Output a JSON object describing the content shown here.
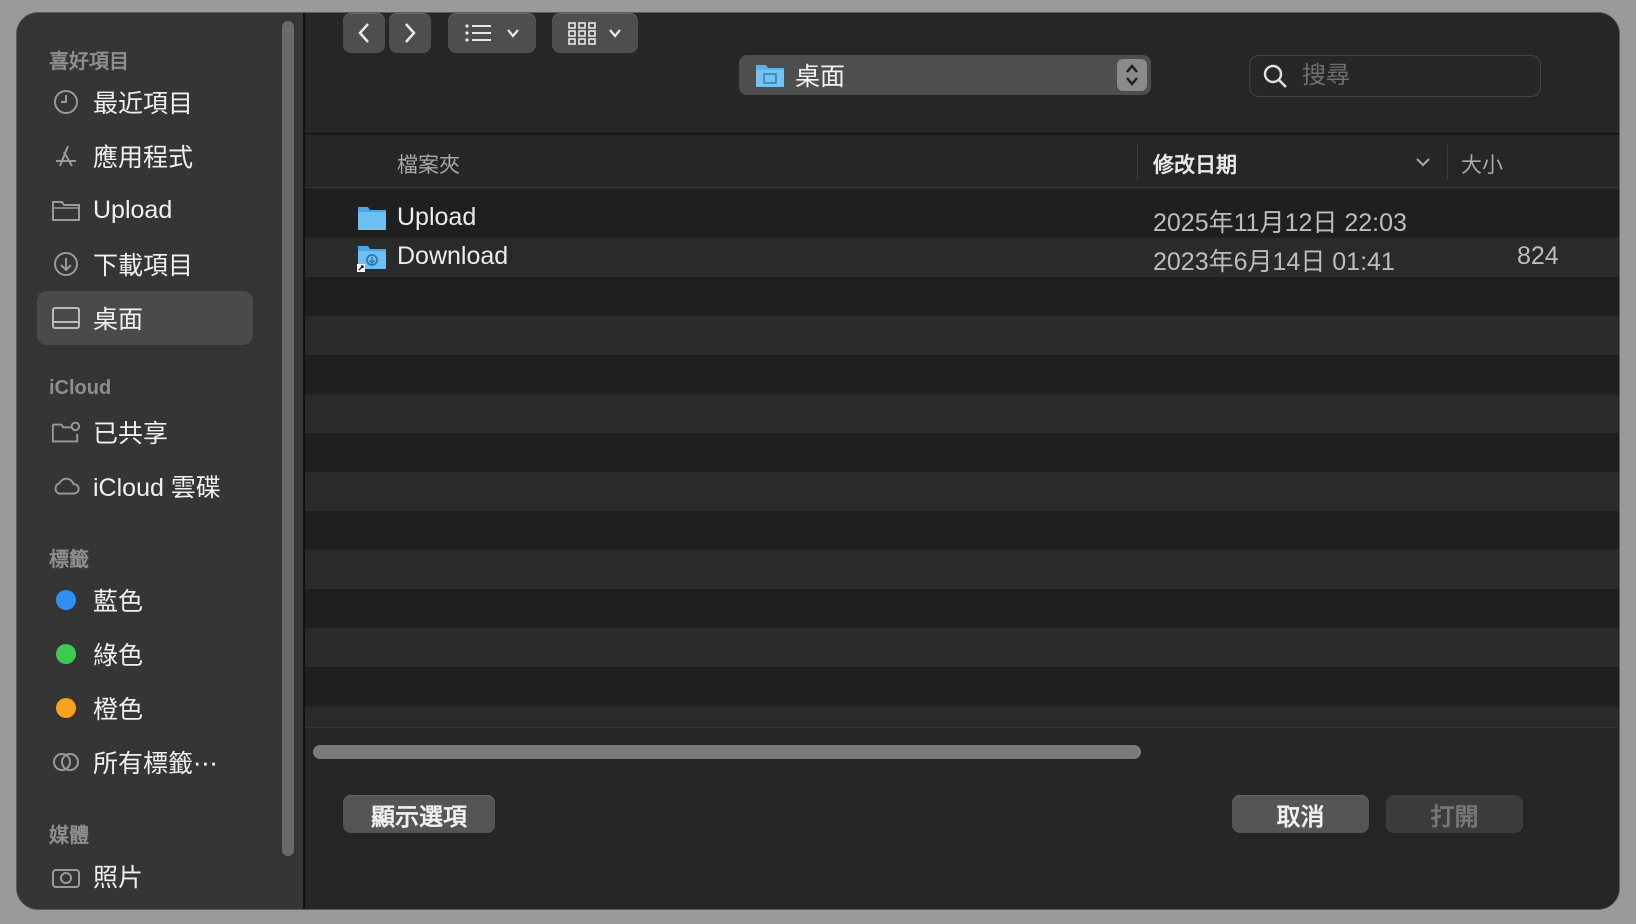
{
  "sidebar": {
    "favorites_title": "喜好項目",
    "favorites": [
      {
        "label": "最近項目",
        "icon": "clock-icon"
      },
      {
        "label": "應用程式",
        "icon": "apps-icon"
      },
      {
        "label": "Upload",
        "icon": "folder-icon"
      },
      {
        "label": "下載項目",
        "icon": "download-icon"
      },
      {
        "label": "桌面",
        "icon": "desktop-icon",
        "selected": true
      }
    ],
    "icloud_title": "iCloud",
    "icloud": [
      {
        "label": "已共享",
        "icon": "shared-folder-icon"
      },
      {
        "label": "iCloud 雲碟",
        "icon": "cloud-icon"
      }
    ],
    "tags_title": "標籤",
    "tags": [
      {
        "label": "藍色",
        "color": "#2f8ff5"
      },
      {
        "label": "綠色",
        "color": "#3ccb4f"
      },
      {
        "label": "橙色",
        "color": "#f8a11a"
      },
      {
        "label": "所有標籤⋯",
        "icon": "all-tags-icon"
      }
    ],
    "media_title": "媒體",
    "media": [
      {
        "label": "照片",
        "icon": "camera-icon"
      }
    ]
  },
  "toolbar": {
    "back_icon": "chevron-left-icon",
    "forward_icon": "chevron-right-icon",
    "view_list_icon": "list-view-icon",
    "view_gallery_icon": "grid-view-icon",
    "location_label": "桌面",
    "search_placeholder": "搜尋"
  },
  "columns": {
    "name": "檔案夾",
    "date": "修改日期",
    "size": "大小"
  },
  "files": [
    {
      "name": "Upload",
      "date": "2025年11月12日 22:03",
      "size": "",
      "icon": "folder-icon"
    },
    {
      "name": "Download",
      "date": "2023年6月14日 01:41",
      "size": "824",
      "icon": "alias-folder-icon"
    }
  ],
  "footer": {
    "options_label": "顯示選項",
    "cancel_label": "取消",
    "open_label": "打開"
  }
}
